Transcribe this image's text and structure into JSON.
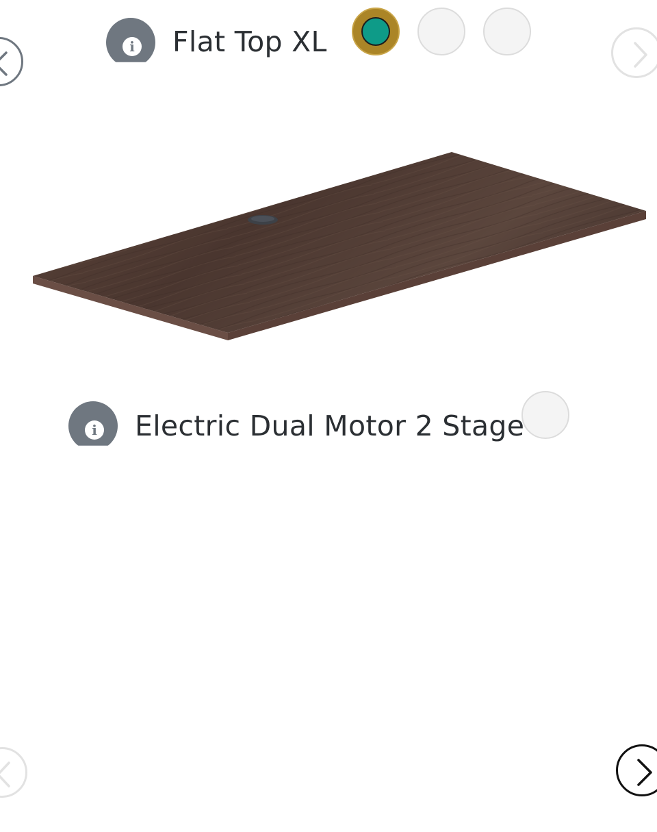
{
  "top_config": {
    "title": "Flat Top XL",
    "info_icon": "info-icon",
    "swatches": [
      {
        "state": "selected",
        "inner_color": "#0e9b88",
        "ring_color": "#ab8527"
      },
      {
        "state": "empty",
        "color": "#f4f4f4"
      },
      {
        "state": "empty",
        "color": "#f4f4f4"
      }
    ],
    "prev_icon": "chevron-left-icon",
    "next_icon": "chevron-right-icon"
  },
  "product_image": {
    "subject": "desk-top",
    "top_color": "#4e3a33",
    "edge_color": "#6a4e45",
    "grommet_color": "#3d4147"
  },
  "frame_config": {
    "title": "Electric Dual Motor 2 Stage",
    "info_icon": "info-icon",
    "swatches": [
      {
        "state": "empty",
        "color": "#f4f4f4"
      }
    ]
  },
  "bottom_nav": {
    "prev_icon": "chevron-left-icon",
    "next_icon": "chevron-right-icon"
  },
  "colors": {
    "text": "#2b2f33",
    "icon_grey": "#6f7780",
    "disabled_ring": "#e2e2e2",
    "active_ring": "#111111"
  }
}
